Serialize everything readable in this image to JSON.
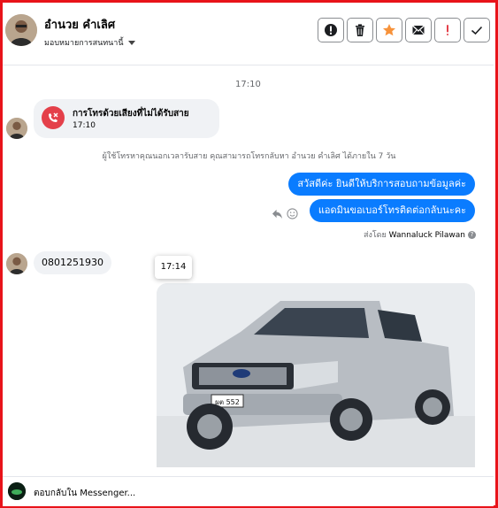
{
  "header": {
    "contact_name": "อำนวย คำเลิศ",
    "assign_label": "มอบหมายการสนทนานี้",
    "tools": [
      "alert-icon",
      "trash-icon",
      "star-icon",
      "mail-icon",
      "important-icon",
      "check-icon"
    ]
  },
  "conversation": {
    "timestamp_1": "17:10",
    "missed_call": {
      "title": "การโทรด้วยเสียงที่ไม่ได้รับสาย",
      "time": "17:10"
    },
    "system_message": "ผู้ใช้โทรหาคุณนอกเวลารับสาย คุณสามารถโทรกลับหา อำนวย คำเลิศ ได้ภายใน 7 วัน",
    "outgoing": [
      "สวัสดีค่ะ  ยินดีให้บริการสอบถามข้อมูลค่ะ",
      "แอดมินขอเบอร์โทรติดต่อกลับนะคะ"
    ],
    "sent_by_prefix": "ส่งโดย",
    "sent_by_name": "Wannaluck Pilawan",
    "incoming_phone": "0801251930",
    "tooltip_time": "17:14",
    "photo": {
      "plate_text": "ผต 552"
    }
  },
  "composer": {
    "placeholder": "ตอบกลับใน Messenger..."
  },
  "colors": {
    "accent": "#0a7cff",
    "frame": "#e8131a",
    "missed_call": "#e4404a",
    "star": "#f7923a",
    "important": "#e4404a"
  }
}
